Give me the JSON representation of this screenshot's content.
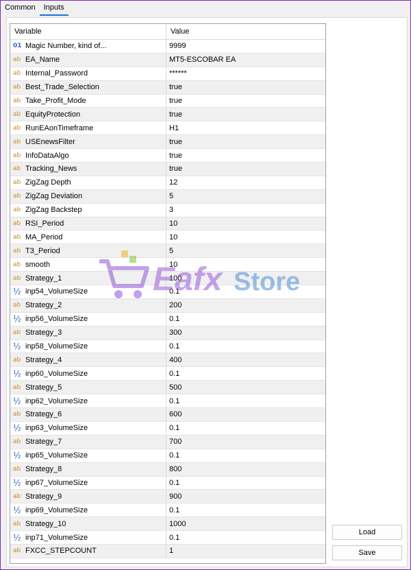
{
  "tabs": [
    {
      "label": "Common",
      "active": false
    },
    {
      "label": "Inputs",
      "active": true
    }
  ],
  "grid": {
    "header": {
      "variable": "Variable",
      "value": "Value"
    },
    "rows": [
      {
        "type": "int",
        "icon": "01",
        "name": "Magic Number, kind of...",
        "value": "9999"
      },
      {
        "type": "str",
        "icon": "ab",
        "name": "EA_Name",
        "value": "MT5-ESCOBAR EA"
      },
      {
        "type": "str",
        "icon": "ab",
        "name": "Internal_Password",
        "value": "******"
      },
      {
        "type": "str",
        "icon": "ab",
        "name": "Best_Trade_Selection",
        "value": "true"
      },
      {
        "type": "str",
        "icon": "ab",
        "name": "Take_Profit_Mode",
        "value": "true"
      },
      {
        "type": "str",
        "icon": "ab",
        "name": "EquityProtection",
        "value": "true"
      },
      {
        "type": "str",
        "icon": "ab",
        "name": "RunEAonTimeframe",
        "value": "H1"
      },
      {
        "type": "str",
        "icon": "ab",
        "name": "USEnewsFilter",
        "value": "true"
      },
      {
        "type": "str",
        "icon": "ab",
        "name": "InfoDataAlgo",
        "value": "true"
      },
      {
        "type": "str",
        "icon": "ab",
        "name": "Tracking_News",
        "value": "true"
      },
      {
        "type": "str",
        "icon": "ab",
        "name": "ZigZag Depth",
        "value": "12"
      },
      {
        "type": "str",
        "icon": "ab",
        "name": "ZigZag Deviation",
        "value": "5"
      },
      {
        "type": "str",
        "icon": "ab",
        "name": "ZigZag Backstep",
        "value": "3"
      },
      {
        "type": "str",
        "icon": "ab",
        "name": "RSI_Period",
        "value": "10"
      },
      {
        "type": "str",
        "icon": "ab",
        "name": "MA_Period",
        "value": "10"
      },
      {
        "type": "str",
        "icon": "ab",
        "name": "T3_Period",
        "value": "5"
      },
      {
        "type": "str",
        "icon": "ab",
        "name": "smooth",
        "value": "10"
      },
      {
        "type": "str",
        "icon": "ab",
        "name": "Strategy_1",
        "value": "100"
      },
      {
        "type": "dbl",
        "icon": "½",
        "name": "inp54_VolumeSize",
        "value": "0.1"
      },
      {
        "type": "str",
        "icon": "ab",
        "name": "Strategy_2",
        "value": "200"
      },
      {
        "type": "dbl",
        "icon": "½",
        "name": "inp56_VolumeSize",
        "value": "0.1"
      },
      {
        "type": "str",
        "icon": "ab",
        "name": "Strategy_3",
        "value": "300"
      },
      {
        "type": "dbl",
        "icon": "½",
        "name": "inp58_VolumeSize",
        "value": "0.1"
      },
      {
        "type": "str",
        "icon": "ab",
        "name": "Strategy_4",
        "value": "400"
      },
      {
        "type": "dbl",
        "icon": "½",
        "name": "inp60_VolumeSize",
        "value": "0.1"
      },
      {
        "type": "str",
        "icon": "ab",
        "name": "Strategy_5",
        "value": "500"
      },
      {
        "type": "dbl",
        "icon": "½",
        "name": "inp62_VolumeSize",
        "value": "0.1"
      },
      {
        "type": "str",
        "icon": "ab",
        "name": "Strategy_6",
        "value": "600"
      },
      {
        "type": "dbl",
        "icon": "½",
        "name": "inp63_VolumeSize",
        "value": "0.1"
      },
      {
        "type": "str",
        "icon": "ab",
        "name": "Strategy_7",
        "value": "700"
      },
      {
        "type": "dbl",
        "icon": "½",
        "name": "inp65_VolumeSize",
        "value": "0.1"
      },
      {
        "type": "str",
        "icon": "ab",
        "name": "Strategy_8",
        "value": "800"
      },
      {
        "type": "dbl",
        "icon": "½",
        "name": "inp67_VolumeSize",
        "value": "0.1"
      },
      {
        "type": "str",
        "icon": "ab",
        "name": "Strategy_9",
        "value": "900"
      },
      {
        "type": "dbl",
        "icon": "½",
        "name": "inp69_VolumeSize",
        "value": "0.1"
      },
      {
        "type": "str",
        "icon": "ab",
        "name": "Strategy_10",
        "value": "1000"
      },
      {
        "type": "dbl",
        "icon": "½",
        "name": "inp71_VolumeSize",
        "value": "0.1"
      },
      {
        "type": "str",
        "icon": "ab",
        "name": "FXCC_STEPCOUNT",
        "value": "1"
      }
    ]
  },
  "buttons": {
    "load": "Load",
    "save": "Save"
  },
  "watermark": {
    "text_a": "Eafx",
    "text_b": "Store"
  },
  "colors": {
    "accent": "#7a2bbd",
    "tab_underline": "#1a73d9",
    "string_icon": "#c28a1c",
    "number_icon": "#2a64c4"
  }
}
